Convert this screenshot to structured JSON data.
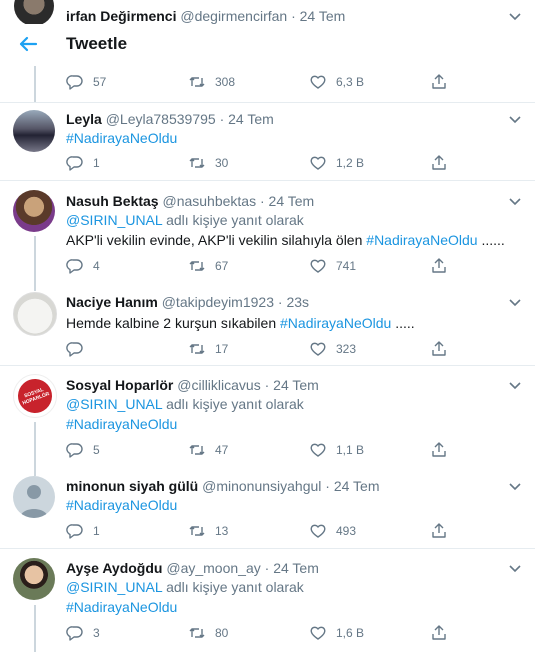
{
  "header": {
    "title": "Tweetle"
  },
  "top_peek": {
    "name": "irfan Değirmenci",
    "handle": "@degirmencirfan",
    "time": "· 24 Tem"
  },
  "first_actions": {
    "replies": "57",
    "retweets": "308",
    "likes": "6,3 B"
  },
  "tweets": [
    {
      "name": "Leyla",
      "handle": "@Leyla78539795",
      "time": "· 24 Tem",
      "hashtag": "#NadirayaNeOldu",
      "replies": "1",
      "retweets": "30",
      "likes": "1,2 B"
    },
    {
      "name": "Nasuh Bektaş",
      "handle": "@nasuhbektas",
      "time": "· 24 Tem",
      "reply_to": "@SIRIN_UNAL",
      "reply_suffix": "adlı kişiye yanıt olarak",
      "text": "AKP'li vekilin evinde, AKP'li vekilin silahıyla ölen",
      "hashtag": "#NadirayaNeOldu",
      "text_after": "......",
      "replies": "4",
      "retweets": "67",
      "likes": "741"
    },
    {
      "name": "Naciye Hanım",
      "handle": "@takipdeyim1923",
      "time": "· 23s",
      "text": "Hemde kalbine 2 kurşun sıkabilen",
      "hashtag": "#NadirayaNeOldu",
      "text_after": ".....",
      "replies": "",
      "retweets": "17",
      "likes": "323"
    },
    {
      "name": "Sosyal Hoparlör",
      "handle": "@cilliklicavus",
      "time": "· 24 Tem",
      "reply_to": "@SIRIN_UNAL",
      "reply_suffix": "adlı kişiye yanıt olarak",
      "hashtag": "#NadirayaNeOldu",
      "replies": "5",
      "retweets": "47",
      "likes": "1,1 B",
      "avatar_text": "SOSYAL HOPARLÖR"
    },
    {
      "name": "minonun siyah gülü",
      "handle": "@minonunsiyahgul",
      "time": "· 24 Tem",
      "hashtag": "#NadirayaNeOldu",
      "replies": "1",
      "retweets": "13",
      "likes": "493"
    },
    {
      "name": "Ayşe Aydoğdu",
      "handle": "@ay_moon_ay",
      "time": "· 24 Tem",
      "reply_to": "@SIRIN_UNAL",
      "reply_suffix": "adlı kişiye yanıt olarak",
      "hashtag": "#NadirayaNeOldu",
      "replies": "3",
      "retweets": "80",
      "likes": "1,6 B"
    }
  ],
  "colors": {
    "link": "#1b95e0",
    "muted": "#657786",
    "divider": "#e6ecf0",
    "thread": "#ccd6dd"
  }
}
